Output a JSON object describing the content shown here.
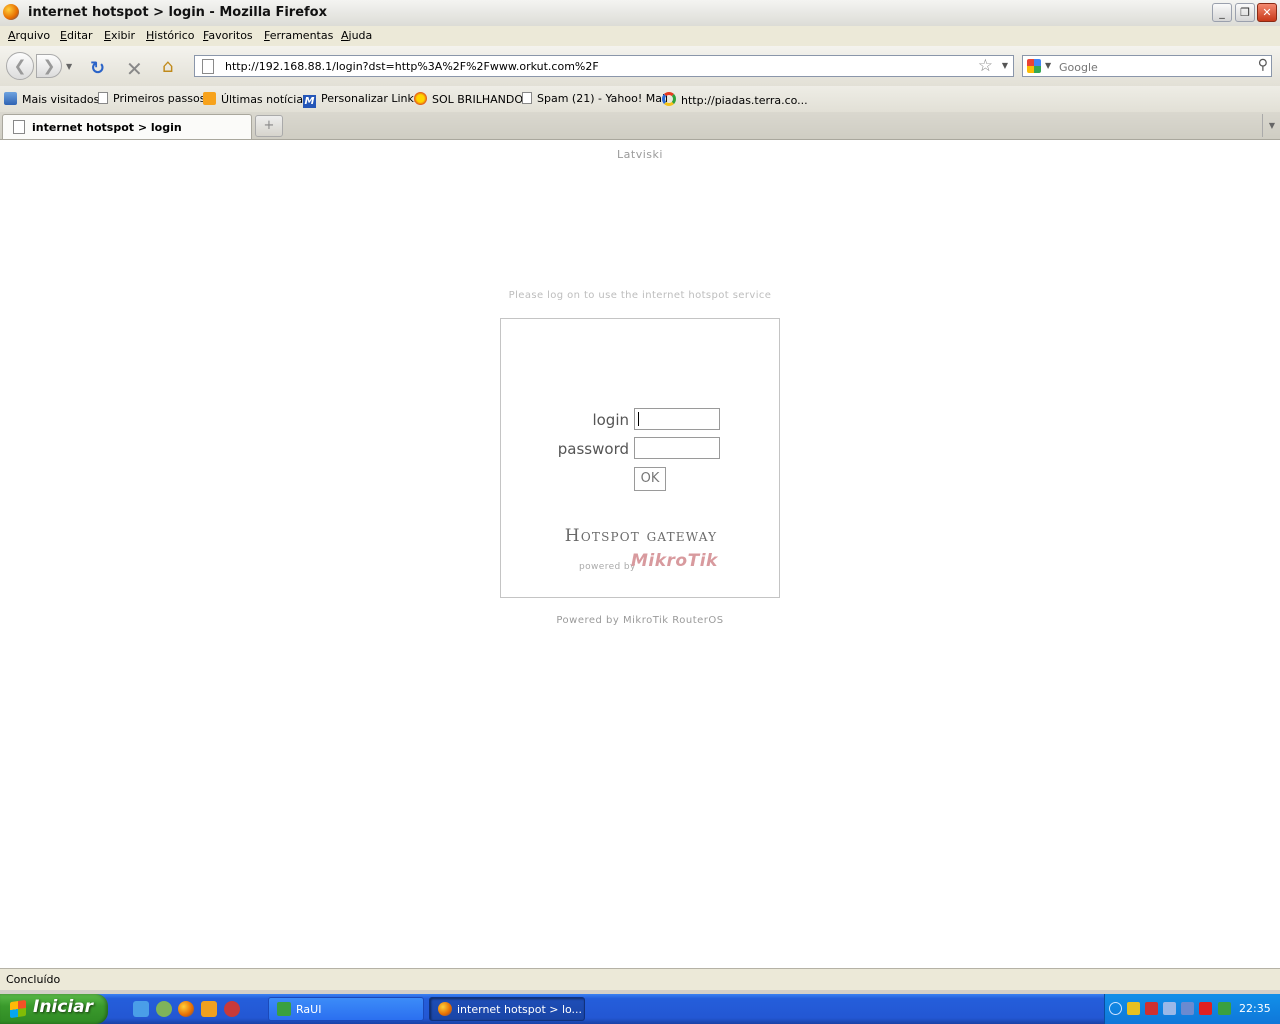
{
  "window": {
    "title": "internet hotspot > login - Mozilla Firefox"
  },
  "menu": [
    "Arquivo",
    "Editar",
    "Exibir",
    "Histórico",
    "Favoritos",
    "Ferramentas",
    "Ajuda"
  ],
  "navigation": {
    "url": "http://192.168.88.1/login?dst=http%3A%2F%2Fwww.orkut.com%2F",
    "search_placeholder": "Google",
    "icons": [
      "back-icon",
      "forward-icon",
      "reload-icon",
      "stop-icon",
      "home-icon",
      "star-icon",
      "search-icon"
    ]
  },
  "bookmarks": [
    {
      "label": "Mais visitados",
      "icon": "most-visited-icon"
    },
    {
      "label": "Primeiros passos",
      "icon": "page-icon"
    },
    {
      "label": "Últimas notícias",
      "icon": "rss-icon"
    },
    {
      "label": "Personalizar Links",
      "icon": "m-icon"
    },
    {
      "label": "SOL BRILHANDO",
      "icon": "sun-icon"
    },
    {
      "label": "Spam (21) - Yahoo! Mail",
      "icon": "page-icon"
    },
    {
      "label": "http://piadas.terra.co...",
      "icon": "ring-icon"
    }
  ],
  "tabs": [
    {
      "label": "internet hotspot > login",
      "active": true
    }
  ],
  "page": {
    "language_link": "Latviski",
    "notice": "Please log on to use the internet hotspot service",
    "login_label": "login",
    "password_label": "password",
    "ok_label": "OK",
    "gateway_title": "Hotspot gateway",
    "powered_by": "powered by",
    "logo_text": "MikroTik",
    "footer": "Powered by MikroTik RouterOS"
  },
  "status": {
    "text": "Concluído"
  },
  "taskbar": {
    "start_label": "Iniciar",
    "tasks": [
      {
        "label": "RaUI"
      },
      {
        "label": "internet hotspot > lo..."
      }
    ],
    "clock": "22:35"
  },
  "colors": {
    "taskbar_blue": "#245edb",
    "start_green": "#3a9a2c",
    "logo_pink": "#d89a9e"
  }
}
